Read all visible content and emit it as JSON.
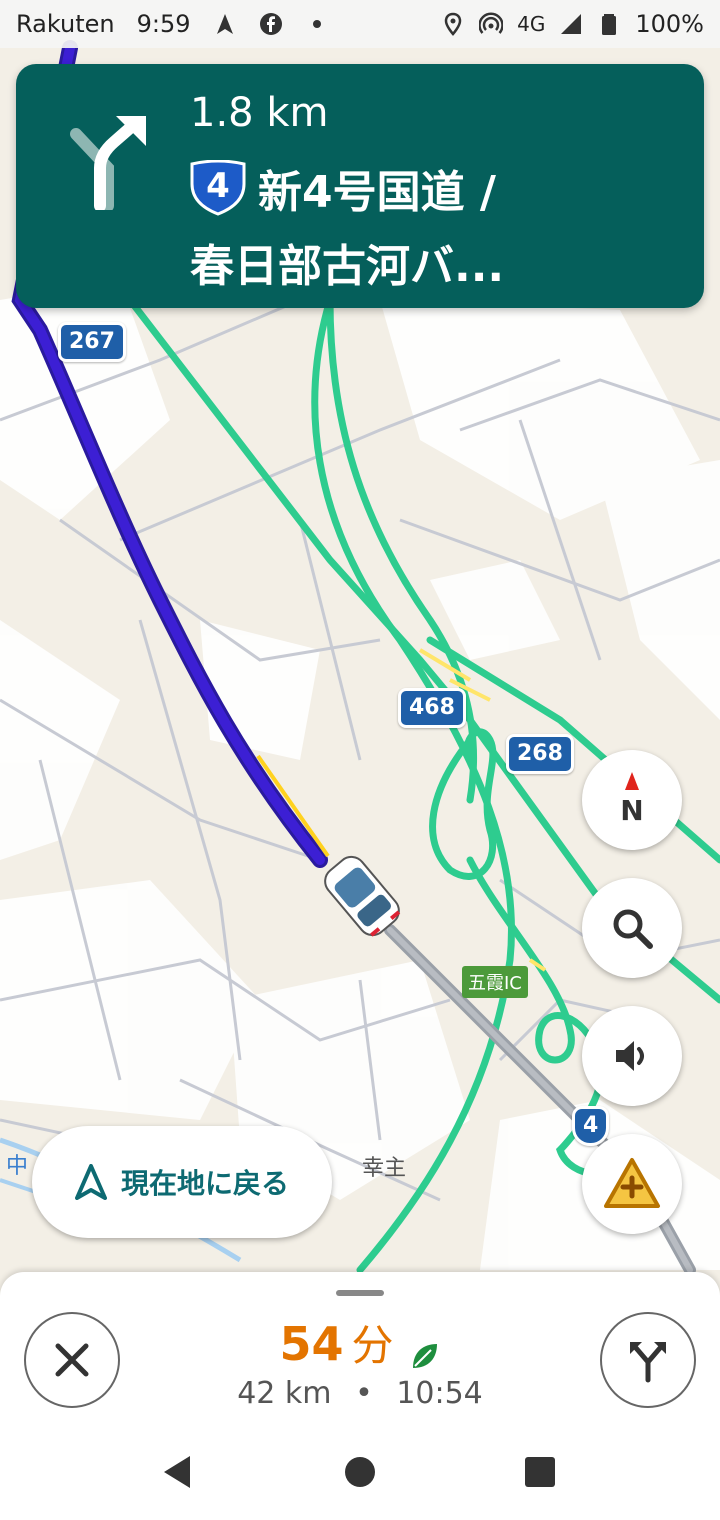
{
  "status_bar": {
    "carrier": "Rakuten",
    "time": "9:59",
    "network": "4G",
    "battery": "100%",
    "icons": [
      "navigation-arrow-icon",
      "facebook-icon",
      "dot-icon",
      "location-pin-icon",
      "hotspot-icon",
      "signal-icon",
      "battery-icon"
    ]
  },
  "navigation": {
    "distance": "1.8 km",
    "route_number": "4",
    "road_name_line1": "新4号国道 /",
    "road_name_line2": "春日部古河バ...",
    "turn": "slight-right"
  },
  "map": {
    "road_badges": [
      "267",
      "468",
      "268",
      "4"
    ],
    "ic_label": "五霞IC",
    "place_label": "幸主",
    "edge_label": "中"
  },
  "buttons": {
    "compass_label": "N",
    "recenter_label": "現在地に戻る"
  },
  "trip": {
    "duration": "54",
    "duration_unit": "分",
    "distance": "42 km",
    "separator": "•",
    "arrival": "10:54"
  },
  "colors": {
    "banner": "#055f5b",
    "route": "#3311cc",
    "eta": "#e37400",
    "expressway": "#2ecc8f"
  }
}
